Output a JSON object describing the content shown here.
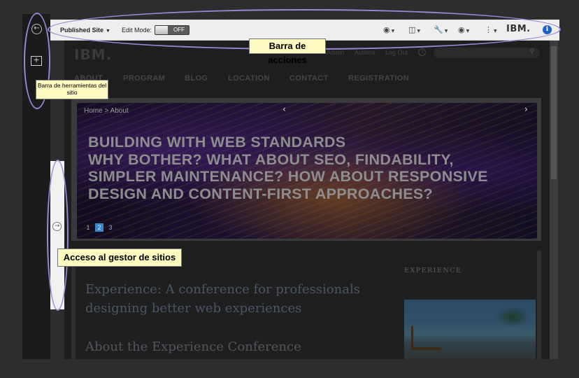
{
  "action_bar": {
    "site_selector": "Published Site",
    "edit_mode_label": "Edit Mode:",
    "edit_mode_state": "OFF",
    "icons": [
      "wordpress-icon",
      "device-icon",
      "wrench-icon",
      "eye-icon",
      "more-icon"
    ],
    "brand": "IBM.",
    "info_glyph": "i"
  },
  "site": {
    "logo": "IBM.",
    "util_links": [
      "Admin",
      "Actions",
      "Log Out"
    ],
    "help_glyph": "?",
    "nav": [
      "ABOUT",
      "PROGRAM",
      "BLOG",
      "LOCATION",
      "CONTACT",
      "REGISTRATION"
    ],
    "hero": {
      "breadcrumb": "Home > About",
      "title_lines": [
        "BUILDING WITH WEB STANDARDS",
        "WHY BOTHER? WHAT ABOUT SEO, FINDABILITY,",
        "SIMPLER MAINTENANCE? HOW ABOUT RESPONSIVE",
        "DESIGN AND CONTENT-FIRST APPROACHES?"
      ],
      "pager": [
        "1",
        "2",
        "3"
      ],
      "active_page": "2"
    },
    "content": {
      "headline": "Experience: A conference for professionals designing better web experiences",
      "subhead": "About the Experience Conference",
      "side_label": "EXPERIENCE"
    }
  },
  "annotations": {
    "action_bar": "Barra de acciones",
    "site_toolbar": "Barra de herramientas del sitio",
    "site_manager": "Acceso al gestor de sitios"
  },
  "colors": {
    "annotation_outline": "#9b86d6",
    "callout_bg": "#fff9c2",
    "info_blue": "#1b63c6",
    "active_page": "#3a88c8"
  }
}
